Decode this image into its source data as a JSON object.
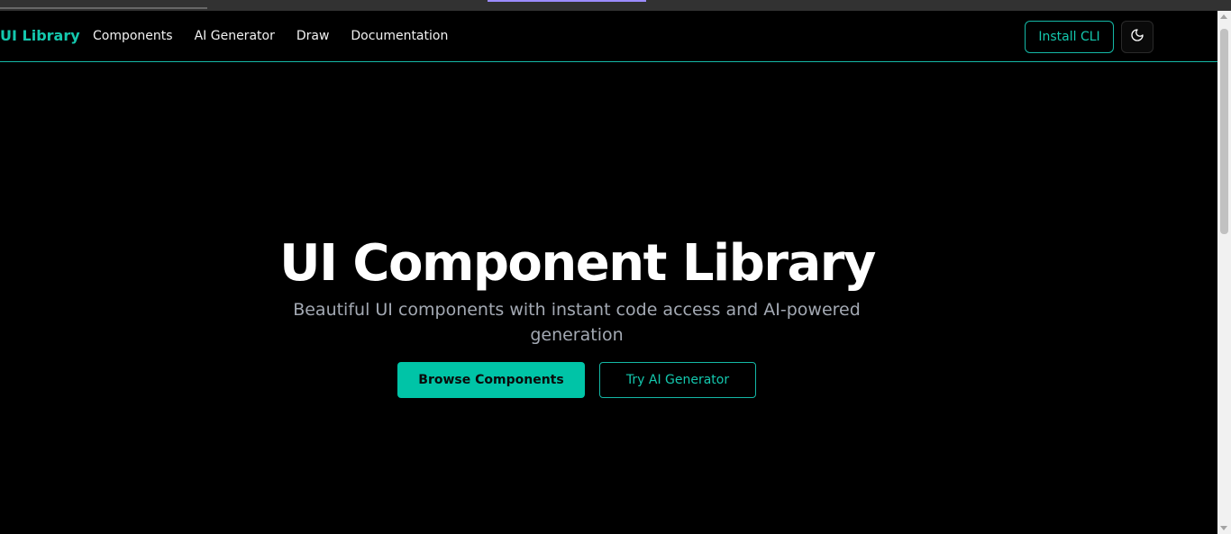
{
  "navbar": {
    "brand": "UI Library",
    "links": [
      "Components",
      "AI Generator",
      "Draw",
      "Documentation"
    ],
    "install_label": "Install CLI",
    "theme_icon": "moon-icon"
  },
  "hero": {
    "title": "UI Component Library",
    "subtitle": "Beautiful UI components with instant code access and AI-powered generation",
    "primary_label": "Browse Components",
    "secondary_label": "Try AI Generator"
  },
  "colors": {
    "background": "#000000",
    "accent": "#14b8a6",
    "primary_button": "#00c4a7",
    "subtitle_text": "#a3a9b3"
  }
}
